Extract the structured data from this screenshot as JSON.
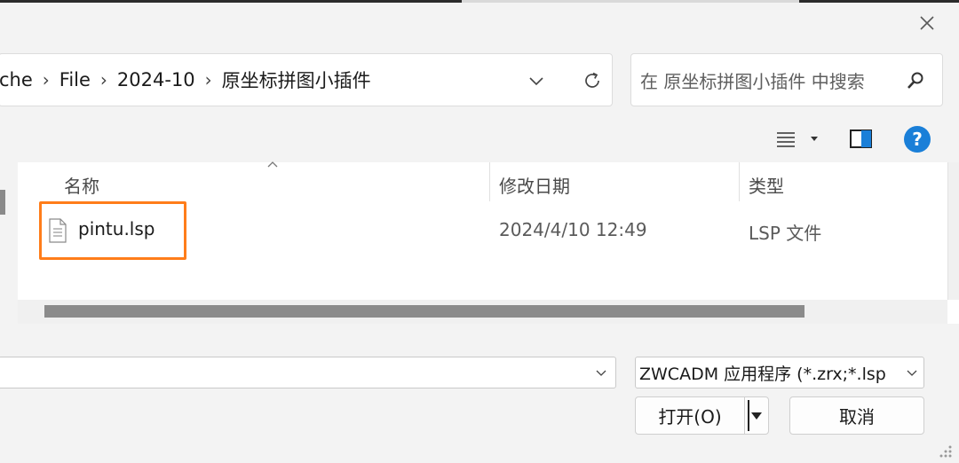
{
  "window": {
    "close_icon": "close-icon"
  },
  "address_bar": {
    "breadcrumbs": [
      "che",
      "File",
      "2024-10",
      "原坐标拼图小插件"
    ],
    "dropdown_icon": "chevron-down-icon",
    "refresh_icon": "refresh-icon"
  },
  "search": {
    "placeholder": "在 原坐标拼图小插件 中搜索",
    "icon": "search-icon"
  },
  "toolbar": {
    "view_icon": "list-view-icon",
    "preview_icon": "preview-pane-icon",
    "help_label": "?"
  },
  "file_list": {
    "columns": [
      "名称",
      "修改日期",
      "类型"
    ],
    "rows": [
      {
        "name": "pintu.lsp",
        "modified": "2024/4/10 12:49",
        "type": "LSP 文件",
        "icon": "document-icon"
      }
    ]
  },
  "bottom": {
    "filename_value": "",
    "filter_value": "ZWCADM 应用程序 (*.zrx;*.lsp",
    "open_label": "打开(O)",
    "cancel_label": "取消"
  },
  "colors": {
    "highlight": "#ff7d1a",
    "help": "#1a7fd8"
  }
}
